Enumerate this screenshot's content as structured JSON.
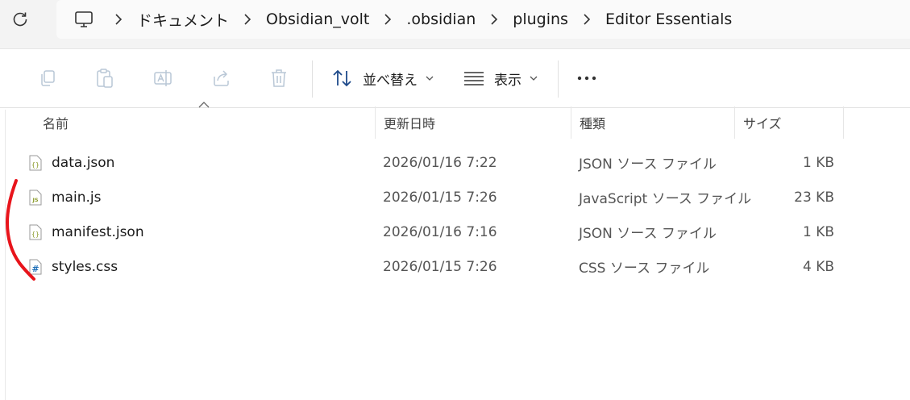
{
  "breadcrumb": {
    "items": [
      "ドキュメント",
      "Obsidian_volt",
      ".obsidian",
      "plugins",
      "Editor Essentials"
    ]
  },
  "toolbar": {
    "sort_label": "並べ替え",
    "view_label": "表示"
  },
  "columns": {
    "name": "名前",
    "date": "更新日時",
    "type": "種類",
    "size": "サイズ"
  },
  "files": [
    {
      "name": "data.json",
      "date": "2026/01/16 7:22",
      "type": "JSON ソース ファイル",
      "size": "1 KB",
      "icon": "json-file-icon"
    },
    {
      "name": "main.js",
      "date": "2026/01/15 7:26",
      "type": "JavaScript ソース ファイル",
      "size": "23 KB",
      "icon": "js-file-icon"
    },
    {
      "name": "manifest.json",
      "date": "2026/01/16 7:16",
      "type": "JSON ソース ファイル",
      "size": "1 KB",
      "icon": "json-file-icon"
    },
    {
      "name": "styles.css",
      "date": "2026/01/15 7:26",
      "type": "CSS ソース ファイル",
      "size": "4 KB",
      "icon": "css-file-icon"
    }
  ],
  "colors": {
    "annotation": "#e8141b",
    "icon_accent": "#8a9a2a",
    "css_icon": "#1e6fb8"
  }
}
